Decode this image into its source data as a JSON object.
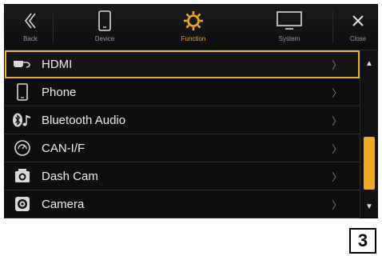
{
  "nav": {
    "back_label": "Back",
    "device_label": "Device",
    "function_label": "Function",
    "system_label": "System",
    "close_label": "Close"
  },
  "list": {
    "items": [
      {
        "label": "HDMI",
        "icon": "hdmi-icon",
        "selected": true
      },
      {
        "label": "Phone",
        "icon": "phone-icon"
      },
      {
        "label": "Bluetooth Audio",
        "icon": "bluetooth-audio-icon"
      },
      {
        "label": "CAN-I/F",
        "icon": "can-interface-icon"
      },
      {
        "label": "Dash Cam",
        "icon": "dash-cam-icon"
      },
      {
        "label": "Camera",
        "icon": "camera-icon"
      }
    ],
    "chevron": "〉"
  },
  "scrollbar": {
    "up": "▲",
    "down": "▼"
  },
  "callout": {
    "number": "3"
  },
  "colors": {
    "accent": "#f1a823",
    "background": "#0e0e0e",
    "text": "#ececec"
  }
}
